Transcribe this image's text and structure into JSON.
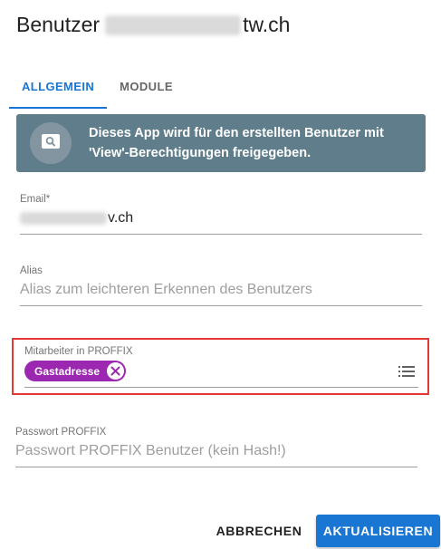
{
  "dialog": {
    "title_prefix": "Benutzer",
    "title_suffix": "tw.ch"
  },
  "tabs": [
    {
      "label": "ALLGEMEIN",
      "active": true
    },
    {
      "label": "MODULE",
      "active": false
    }
  ],
  "info_banner": {
    "text_line1": "Dieses App wird für den erstellten Benutzer mit",
    "text_line2": "'View'-Berechtigungen freigegeben.",
    "icon": "search-icon",
    "color": "#607d8b"
  },
  "form": {
    "email": {
      "label": "Email*",
      "value_suffix": "v.ch"
    },
    "alias": {
      "label": "Alias",
      "placeholder": "Alias zum leichteren Erkennen des Benutzers"
    },
    "mitarbeiter": {
      "label": "Mitarbeiter in PROFFIX",
      "chip_label": "Gastadresse",
      "chip_color": "#9c27b0",
      "list_icon": "list-icon"
    },
    "passwort": {
      "label": "Passwort PROFFIX",
      "placeholder": "Passwort PROFFIX Benutzer (kein Hash!)"
    }
  },
  "actions": {
    "cancel_label": "ABBRECHEN",
    "submit_label": "AKTUALISIEREN",
    "primary_color": "#1976d2"
  }
}
